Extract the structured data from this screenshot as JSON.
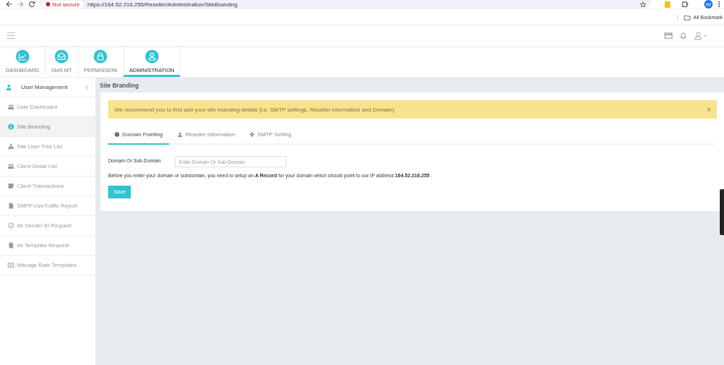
{
  "browser": {
    "security_label": "Not secure",
    "url": "https://164.52.216.255/Reseller/Administration/SiteBranding",
    "profile_initial": "W",
    "bookmarks_label": "All Bookmark"
  },
  "modules": [
    {
      "label": "DASHBOARD",
      "selected": false
    },
    {
      "label": "SMS MT",
      "selected": false
    },
    {
      "label": "PERMISSION",
      "selected": false
    },
    {
      "label": "ADMINISTRATION",
      "selected": true
    }
  ],
  "sidebar": {
    "heading": "User Management",
    "items": [
      {
        "label": "User Dashboard",
        "selected": false
      },
      {
        "label": "Site Branding",
        "selected": true
      },
      {
        "label": "Site User Tree List",
        "selected": false
      },
      {
        "label": "Client Detail List",
        "selected": false
      },
      {
        "label": "Client Transactions",
        "selected": false
      },
      {
        "label": "SMPP LiveTraffic Report",
        "selected": false
      },
      {
        "label": "All Sender ID Request",
        "selected": false
      },
      {
        "label": "All Template Request",
        "selected": false
      },
      {
        "label": "Manage Rate Templates",
        "selected": false
      }
    ]
  },
  "page_title": "Site Branding",
  "alert": {
    "text": "We recommend you to first add your site branding details (i.e. SMTP settings, Reseller information and Domain)",
    "close": "×"
  },
  "tabs": [
    {
      "label": "Domain Pointing",
      "selected": true
    },
    {
      "label": "Reseller Information",
      "selected": false
    },
    {
      "label": "SMTP Setting",
      "selected": false
    }
  ],
  "form": {
    "label": "Domain Or Sub-Domain",
    "placeholder": "Enter Domain Or Sub-Domain",
    "note": "Before you enter your domain or subdomain, you need to setup an **A Record** for your domain which should point to our IP address **164.52.216.255** .",
    "save": "Save"
  }
}
